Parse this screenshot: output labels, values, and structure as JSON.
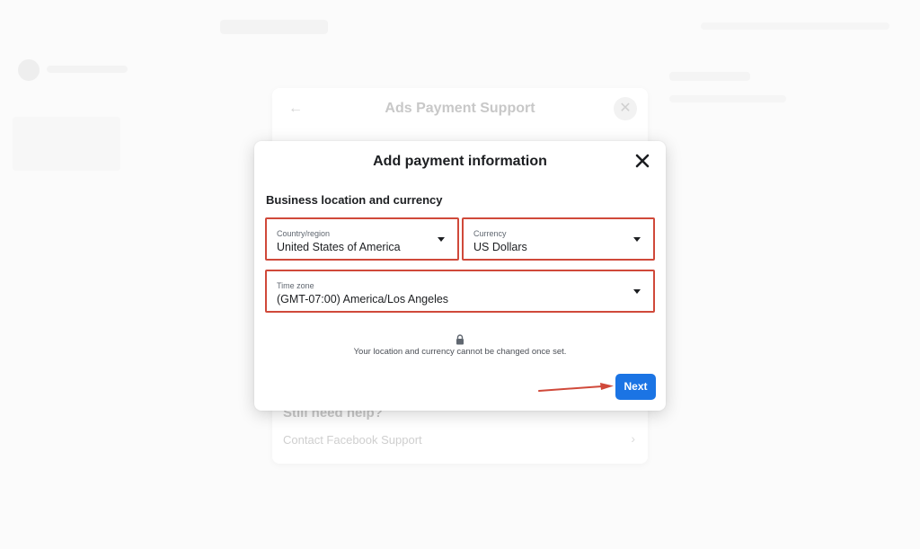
{
  "background": {
    "dialog_title": "Ads Payment Support",
    "back_icon": "arrow-left-icon",
    "close_icon": "close-icon",
    "help_heading": "Still need help?",
    "contact_link": "Contact Facebook Support",
    "chevron_icon": "chevron-right-icon"
  },
  "modal": {
    "title": "Add payment information",
    "close_icon": "close-icon",
    "section_title": "Business location and currency",
    "fields": {
      "country": {
        "label": "Country/region",
        "value": "United States of America"
      },
      "currency": {
        "label": "Currency",
        "value": "US Dollars"
      },
      "timezone": {
        "label": "Time zone",
        "value": "(GMT-07:00) America/Los Angeles"
      }
    },
    "lock_icon": "lock-icon",
    "note": "Your location and currency cannot be changed once set.",
    "next_label": "Next"
  },
  "annotations": {
    "highlight_color": "#d0493a",
    "arrow_color": "#d0493a"
  },
  "colors": {
    "primary": "#1b74e4",
    "text": "#1c1e21"
  }
}
